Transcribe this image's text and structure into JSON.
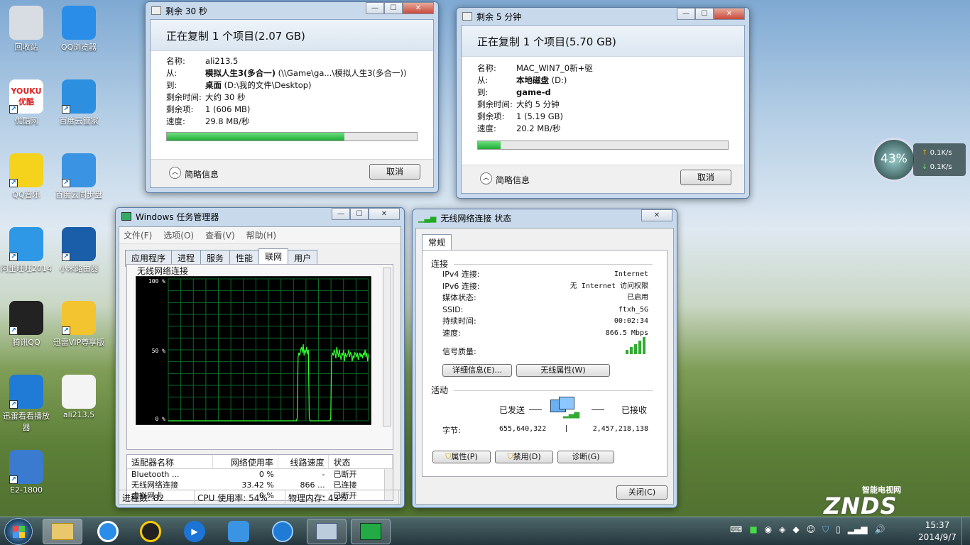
{
  "desktop_icons": [
    {
      "label": "回收站",
      "icon": "recycle-bin-icon",
      "color": "#d8dde3",
      "text": ""
    },
    {
      "label": "QQ浏览器",
      "icon": "qq-browser-icon",
      "color": "#2a8ee8",
      "text": ""
    },
    {
      "label": "优酷网",
      "icon": "youku-icon",
      "color": "#ffffff",
      "text": "YOUKU 优酷"
    },
    {
      "label": "百度云管家",
      "icon": "baidu-cloud-icon",
      "color": "#2c8fe0",
      "text": ""
    },
    {
      "label": "QQ音乐",
      "icon": "qq-music-icon",
      "color": "#f5d21c",
      "text": ""
    },
    {
      "label": "百度云同步盘",
      "icon": "baidu-sync-icon",
      "color": "#3a94e3",
      "text": ""
    },
    {
      "label": "阿里旺旺2014",
      "icon": "aliwangwang-icon",
      "color": "#2e98e6",
      "text": ""
    },
    {
      "label": "小米路由器",
      "icon": "mi-router-icon",
      "color": "#1a5da8",
      "text": ""
    },
    {
      "label": "腾讯QQ",
      "icon": "qq-penguin-icon",
      "color": "#222222",
      "text": ""
    },
    {
      "label": "迅雷VIP尊享版",
      "icon": "xunlei-vip-icon",
      "color": "#f4c430",
      "text": ""
    },
    {
      "label": "迅雷看看播放器",
      "icon": "xunlei-player-icon",
      "color": "#1f7bd6",
      "text": ""
    },
    {
      "label": "ali213.5",
      "icon": "file-icon",
      "color": "#f4f4f4",
      "text": ""
    },
    {
      "label": "E2-1800",
      "icon": "computer-icon",
      "color": "#3a7bd0",
      "text": ""
    }
  ],
  "copy1": {
    "title": "剩余 30 秒",
    "heading": "正在复制 1 个项目(2.07 GB)",
    "rows": [
      {
        "k": "名称:",
        "v": "ali213.5",
        "b": ""
      },
      {
        "k": "从:",
        "v": " (\\\\Game\\ga...\\模拟人生3(多合一))",
        "b": "模拟人生3(多合一)"
      },
      {
        "k": "到:",
        "v": " (D:\\我的文件\\Desktop)",
        "b": "桌面"
      },
      {
        "k": "剩余时间:",
        "v": "大约 30 秒",
        "b": ""
      },
      {
        "k": "剩余项:",
        "v": "1 (606 MB)",
        "b": ""
      },
      {
        "k": "速度:",
        "v": "29.8 MB/秒",
        "b": ""
      }
    ],
    "progress": 0.71,
    "details": "简略信息",
    "cancel": "取消"
  },
  "copy2": {
    "title": "剩余 5 分钟",
    "heading": "正在复制 1 个项目(5.70 GB)",
    "rows": [
      {
        "k": "名称:",
        "v": "MAC_WIN7_0新+驱",
        "b": ""
      },
      {
        "k": "从:",
        "v": " (D:)",
        "b": "本地磁盘"
      },
      {
        "k": "到:",
        "v": "",
        "b": "game-d"
      },
      {
        "k": "剩余时间:",
        "v": "大约 5 分钟",
        "b": ""
      },
      {
        "k": "剩余项:",
        "v": "1 (5.19 GB)",
        "b": ""
      },
      {
        "k": "速度:",
        "v": "20.2 MB/秒",
        "b": ""
      }
    ],
    "progress": 0.09,
    "details": "简略信息",
    "cancel": "取消"
  },
  "taskmgr": {
    "title": "Windows 任务管理器",
    "menu": [
      "文件(F)",
      "选项(O)",
      "查看(V)",
      "帮助(H)"
    ],
    "tabs": [
      "应用程序",
      "进程",
      "服务",
      "性能",
      "联网",
      "用户"
    ],
    "active_tab": 4,
    "graph_title": "无线网络连接",
    "y_labels": [
      "100 %",
      "50 %",
      "0 %"
    ],
    "table_headers": [
      "适配器名称",
      "网络使用率",
      "线路速度",
      "状态"
    ],
    "table_rows": [
      [
        "Bluetooth ...",
        "0 %",
        "-",
        "已断开"
      ],
      [
        "无线网络连接",
        "33.42 %",
        "866 ...",
        "已连接"
      ],
      [
        "虚拟网卡",
        "0 %",
        "-",
        "已断开"
      ]
    ],
    "status": [
      "进程数: 82",
      "CPU 使用率: 54%",
      "物理内存: 43%"
    ],
    "usage_series": [
      0,
      0,
      0,
      0,
      0,
      0,
      0,
      0,
      0,
      0,
      0,
      0,
      0,
      0,
      0,
      0,
      0,
      0,
      0,
      0,
      0,
      0,
      0,
      0,
      0,
      0,
      0,
      0,
      0,
      0,
      0,
      0,
      0,
      0,
      0,
      0,
      0,
      0,
      0,
      0,
      0,
      0,
      0,
      0,
      0,
      0,
      0,
      0,
      0,
      0,
      0,
      0,
      0,
      0,
      0,
      0,
      0,
      0,
      0,
      0,
      0,
      0,
      0,
      0,
      0,
      0,
      0,
      0,
      0,
      0,
      0,
      0,
      0,
      0,
      0,
      0,
      0,
      0,
      0,
      0,
      0,
      0,
      0,
      0,
      0,
      0,
      0,
      0,
      0,
      0,
      0,
      0,
      0,
      0,
      0,
      0,
      0,
      0,
      0,
      0,
      0,
      0,
      0,
      0,
      0,
      0,
      0,
      0,
      0,
      0,
      0,
      0,
      0,
      0,
      0,
      0,
      0,
      0,
      0,
      0,
      0,
      0,
      0,
      0,
      0,
      0,
      0,
      0,
      0,
      0,
      0,
      0,
      0,
      0,
      0,
      0,
      0,
      0,
      0,
      0,
      0,
      0,
      0,
      0,
      0,
      0,
      0,
      0,
      0,
      0,
      2,
      45,
      48,
      46,
      50,
      52,
      48,
      54,
      46,
      50,
      48,
      52,
      47,
      50,
      2,
      0,
      0,
      0,
      0,
      0,
      0,
      0,
      0,
      0,
      0,
      0,
      0,
      0,
      0,
      0,
      0,
      0,
      0,
      0,
      0,
      0,
      0,
      0,
      0,
      2,
      45,
      48,
      46,
      50,
      48,
      44,
      52,
      48,
      45,
      50,
      46,
      43,
      48,
      46,
      50,
      42,
      48,
      45,
      46,
      47,
      50,
      45,
      48,
      47,
      42,
      46,
      44,
      48,
      47,
      45,
      48,
      43,
      46,
      48,
      45,
      47,
      44,
      48,
      46,
      50,
      45,
      48,
      42,
      47
    ]
  },
  "wifi": {
    "title": "无线网络连接 状态",
    "tab": "常规",
    "section_conn": "连接",
    "rows": [
      {
        "k": "IPv4 连接:",
        "v": "Internet"
      },
      {
        "k": "IPv6 连接:",
        "v": "无 Internet 访问权限"
      },
      {
        "k": "媒体状态:",
        "v": "已启用"
      },
      {
        "k": "SSID:",
        "v": "ftxh_5G"
      },
      {
        "k": "持续时间:",
        "v": "00:02:34"
      },
      {
        "k": "速度:",
        "v": "866.5 Mbps"
      }
    ],
    "signal_label": "信号质量:",
    "details_btn": "详细信息(E)...",
    "props_btn": "无线属性(W)",
    "section_activity": "活动",
    "sent": "已发送",
    "recv": "已接收",
    "bytes_label": "字节:",
    "bytes_sent": "655,640,322",
    "bytes_recv": "2,457,218,138",
    "btn_props": "属性(P)",
    "btn_disable": "禁用(D)",
    "btn_diag": "诊断(G)",
    "btn_close": "关闭(C)"
  },
  "gadget": {
    "percent": "43%",
    "up": "0.1K/s",
    "down": "0.1K/s"
  },
  "watermark": {
    "top": "智能电视网",
    "main": "ZNDS",
    ".com": ".com"
  },
  "clock": {
    "time": "15:37",
    "date": "2014/9/7"
  }
}
